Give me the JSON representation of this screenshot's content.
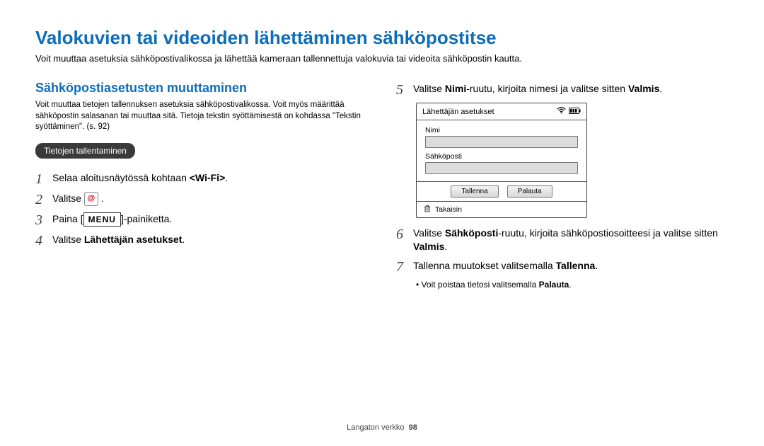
{
  "title": "Valokuvien tai videoiden lähettäminen sähköpostitse",
  "intro": "Voit muuttaa asetuksia sähköpostivalikossa ja lähettää kameraan tallennettuja valokuvia tai videoita sähköpostin kautta.",
  "section_heading": "Sähköpostiasetusten muuttaminen",
  "section_intro": "Voit muuttaa tietojen tallennuksen asetuksia sähköpostivalikossa. Voit myös määrittää sähköpostin salasanan tai muuttaa sitä. Tietoja tekstin syöttämisestä on kohdassa \"Tekstin syöttäminen\". (s. 92)",
  "pill_label": "Tietojen tallentaminen",
  "steps_left": {
    "1": [
      "Selaa aloitusnäytössä kohtaan ",
      "<Wi-Fi>",
      "."
    ],
    "2": [
      "Valitse ",
      "ICON_EMAIL",
      " ."
    ],
    "3": [
      "Paina [",
      "MENUBOX",
      "]-painiketta."
    ],
    "4": [
      "Valitse ",
      "Lähettäjän asetukset",
      "."
    ]
  },
  "steps_right": {
    "5": [
      "Valitse ",
      "Nimi",
      "-ruutu, kirjoita nimesi ja valitse sitten ",
      "Valmis",
      "."
    ],
    "6": [
      "Valitse ",
      "Sähköposti",
      "-ruutu, kirjoita sähköpostiosoitteesi ja valitse sitten ",
      "Valmis",
      "."
    ],
    "7": [
      "Tallenna muutokset valitsemalla ",
      "Tallenna",
      "."
    ]
  },
  "device": {
    "title": "Lähettäjän asetukset",
    "label_name": "Nimi",
    "label_email": "Sähköposti",
    "btn_save": "Tallenna",
    "btn_restore": "Palauta",
    "back": "Takaisin"
  },
  "menu_text": "MENU",
  "note": [
    "Voit poistaa tietosi valitsemalla ",
    "Palauta",
    "."
  ],
  "footer": {
    "text": "Langaton verkko",
    "page": "98"
  }
}
